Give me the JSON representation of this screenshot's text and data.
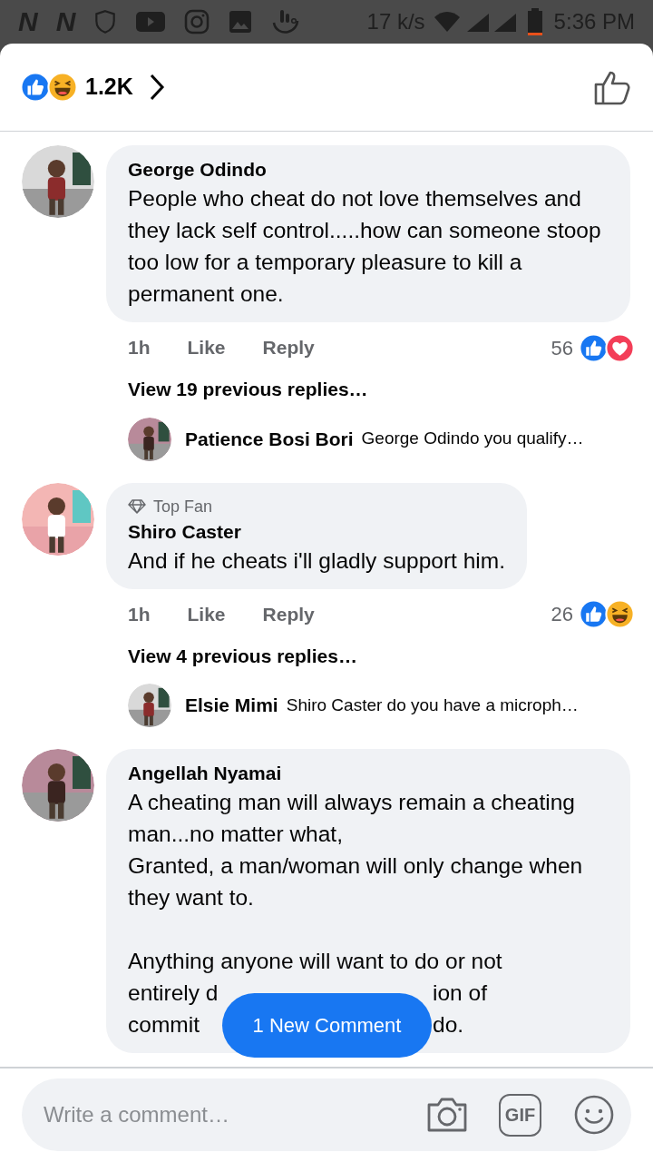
{
  "status_bar": {
    "app_glyphs": [
      "N",
      "N"
    ],
    "speed": "17 k/s",
    "time": "5:36 PM"
  },
  "header": {
    "reactions": [
      {
        "kind": "like"
      },
      {
        "kind": "haha"
      }
    ],
    "count": "1.2K"
  },
  "comments": [
    {
      "author": "George Odindo",
      "text": "People who cheat do not love themselves and they lack self control.....how can someone stoop too low for a temporary pleasure to kill a permanent one.",
      "time": "1h",
      "actions": [
        "Like",
        "Reply"
      ],
      "reaction_count": "56",
      "reactions": [
        {
          "kind": "like"
        },
        {
          "kind": "love"
        }
      ],
      "replies_link": "View 19 previous replies…",
      "reply": {
        "author": "Patience Bosi Bori",
        "text": "George Odindo you qualify…"
      }
    },
    {
      "badge": "Top Fan",
      "author": "Shiro Caster",
      "text": "And if he cheats i'll gladly support him.",
      "time": "1h",
      "actions": [
        "Like",
        "Reply"
      ],
      "reaction_count": "26",
      "reactions": [
        {
          "kind": "like"
        },
        {
          "kind": "haha"
        }
      ],
      "replies_link": "View 4 previous replies…",
      "reply": {
        "author": "Elsie Mimi",
        "text": "Shiro Caster do you have a microph…"
      }
    },
    {
      "author": "Angellah Nyamai",
      "text": "A cheating man will always remain a cheating man...no matter what,\nGranted, a man/woman will only change when they want to.",
      "lines": [
        {
          "text": "Anything anyone will want to do or not"
        },
        {
          "left": "entirely d",
          "right": "ion of"
        },
        {
          "left": "commit",
          "right": "do."
        }
      ]
    }
  ],
  "new_comment_button": "1 New Comment",
  "composer": {
    "placeholder": "Write a comment…",
    "gif_label": "GIF"
  }
}
